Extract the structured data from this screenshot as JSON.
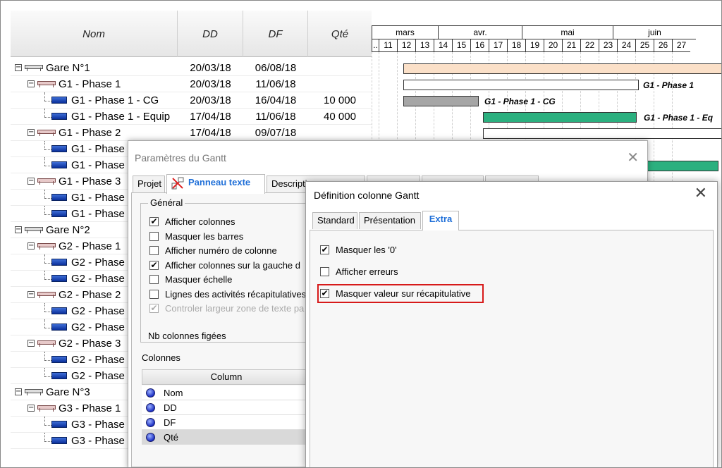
{
  "table": {
    "headers": {
      "nom": "Nom",
      "dd": "DD",
      "df": "DF",
      "qte": "Qté"
    },
    "rows": [
      {
        "level": 0,
        "type": "gare",
        "name": "Gare N°1",
        "dd": "20/03/18",
        "df": "06/08/18",
        "qte": ""
      },
      {
        "level": 1,
        "type": "phase",
        "name": "G1 - Phase 1",
        "dd": "20/03/18",
        "df": "11/06/18",
        "qte": ""
      },
      {
        "level": 2,
        "type": "task",
        "name": "G1 - Phase 1 - CG",
        "dd": "20/03/18",
        "df": "16/04/18",
        "qte": "10 000"
      },
      {
        "level": 2,
        "type": "task",
        "name": "G1 - Phase 1 - Equip",
        "dd": "17/04/18",
        "df": "11/06/18",
        "qte": "40 000"
      },
      {
        "level": 1,
        "type": "phase",
        "name": "G1 - Phase 2",
        "dd": "17/04/18",
        "df": "09/07/18",
        "qte": ""
      },
      {
        "level": 2,
        "type": "task",
        "name": "G1 - Phase",
        "dd": "",
        "df": "",
        "qte": ""
      },
      {
        "level": 2,
        "type": "task",
        "name": "G1 - Phase",
        "dd": "",
        "df": "",
        "qte": ""
      },
      {
        "level": 1,
        "type": "phase",
        "name": "G1 - Phase 3",
        "dd": "",
        "df": "",
        "qte": ""
      },
      {
        "level": 2,
        "type": "task",
        "name": "G1 - Phase",
        "dd": "",
        "df": "",
        "qte": ""
      },
      {
        "level": 2,
        "type": "task",
        "name": "G1 - Phase",
        "dd": "",
        "df": "",
        "qte": ""
      },
      {
        "level": 0,
        "type": "gare",
        "name": "Gare N°2",
        "dd": "",
        "df": "",
        "qte": ""
      },
      {
        "level": 1,
        "type": "phase",
        "name": "G2 - Phase 1",
        "dd": "",
        "df": "",
        "qte": ""
      },
      {
        "level": 2,
        "type": "task",
        "name": "G2 - Phase",
        "dd": "",
        "df": "",
        "qte": ""
      },
      {
        "level": 2,
        "type": "task",
        "name": "G2 - Phase",
        "dd": "",
        "df": "",
        "qte": ""
      },
      {
        "level": 1,
        "type": "phase",
        "name": "G2 - Phase 2",
        "dd": "",
        "df": "",
        "qte": ""
      },
      {
        "level": 2,
        "type": "task",
        "name": "G2 - Phase",
        "dd": "",
        "df": "",
        "qte": ""
      },
      {
        "level": 2,
        "type": "task",
        "name": "G2 - Phase",
        "dd": "",
        "df": "",
        "qte": ""
      },
      {
        "level": 1,
        "type": "phase",
        "name": "G2 - Phase 3",
        "dd": "",
        "df": "",
        "qte": ""
      },
      {
        "level": 2,
        "type": "task",
        "name": "G2 - Phase",
        "dd": "",
        "df": "",
        "qte": ""
      },
      {
        "level": 2,
        "type": "task",
        "name": "G2 - Phase",
        "dd": "",
        "df": "",
        "qte": ""
      },
      {
        "level": 0,
        "type": "gare",
        "name": "Gare N°3",
        "dd": "",
        "df": "",
        "qte": ""
      },
      {
        "level": 1,
        "type": "phase",
        "name": "G3 - Phase 1",
        "dd": "",
        "df": "",
        "qte": ""
      },
      {
        "level": 2,
        "type": "task",
        "name": "G3 - Phase",
        "dd": "",
        "df": "",
        "qte": ""
      },
      {
        "level": 2,
        "type": "task",
        "name": "G3 - Phase",
        "dd": "",
        "df": "",
        "qte": ""
      }
    ]
  },
  "gantt": {
    "months": [
      "mars",
      "avr.",
      "mai",
      "juin"
    ],
    "weeks": [
      "..",
      "11",
      "12",
      "13",
      "14",
      "15",
      "16",
      "17",
      "18",
      "19",
      "20",
      "21",
      "22",
      "23",
      "24",
      "25",
      "26",
      "27"
    ],
    "bar_labels": [
      "G1 - Phase 1",
      "G1 - Phase 1 - CG",
      "G1 - Phase 1 - Eq"
    ],
    "colors": {
      "summary": "#fbe0c8",
      "task_done": "#a6a6a6",
      "task": "#2bb07f"
    }
  },
  "params_dialog": {
    "title": "Paramètres du Gantt",
    "tabs": [
      "Projet",
      "Panneau texte",
      "Descripti",
      "",
      "",
      ""
    ],
    "group_label": "Général",
    "options": [
      {
        "label": "Afficher colonnes",
        "checked": true,
        "disabled": false
      },
      {
        "label": "Masquer les barres",
        "checked": false,
        "disabled": false
      },
      {
        "label": "Afficher numéro de colonne",
        "checked": false,
        "disabled": false
      },
      {
        "label": "Afficher colonnes sur la gauche d",
        "checked": true,
        "disabled": false
      },
      {
        "label": "Masquer échelle",
        "checked": false,
        "disabled": false
      },
      {
        "label": "Lignes des activités récapitulatives",
        "checked": false,
        "disabled": false
      },
      {
        "label": "Controler largeur zone de texte pa",
        "checked": true,
        "disabled": true
      }
    ],
    "frozen_label": "Nb colonnes figées",
    "columns_label": "Colonnes",
    "columns_header": "Column",
    "columns": [
      "Nom",
      "DD",
      "DF",
      "Qté"
    ]
  },
  "col_dialog": {
    "title": "Définition colonne Gantt",
    "tabs": [
      "Standard",
      "Présentation",
      "Extra"
    ],
    "options": [
      {
        "label": "Masquer les '0'",
        "checked": true
      },
      {
        "label": "Afficher erreurs",
        "checked": false
      },
      {
        "label": "Masquer valeur sur récapitulative",
        "checked": true
      }
    ]
  }
}
